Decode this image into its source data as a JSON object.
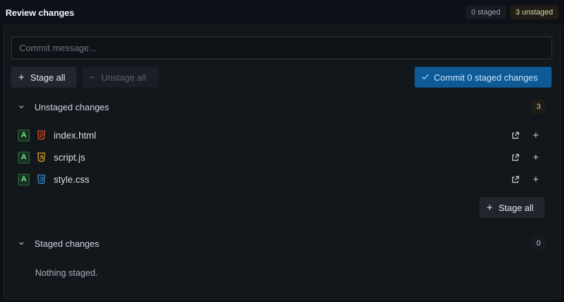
{
  "header": {
    "title": "Review changes",
    "staged_badge": "0 staged",
    "unstaged_badge": "3 unstaged"
  },
  "commit": {
    "placeholder": "Commit message...",
    "value": ""
  },
  "toolbar": {
    "stage_all_label": "Stage all",
    "unstage_all_label": "Unstage all",
    "commit_label": "Commit 0 staged changes"
  },
  "unstaged": {
    "label": "Unstaged changes",
    "count": "3",
    "files": [
      {
        "status": "A",
        "name": "index.html",
        "type_icon": "html5-icon",
        "type_color": "#e34c26"
      },
      {
        "status": "A",
        "name": "script.js",
        "type_icon": "js-icon",
        "type_color": "#d9a22a"
      },
      {
        "status": "A",
        "name": "style.css",
        "type_icon": "css3-icon",
        "type_color": "#3b8fd8"
      }
    ],
    "stage_all_label": "Stage all"
  },
  "staged": {
    "label": "Staged changes",
    "count": "0",
    "empty_text": "Nothing staged."
  },
  "colors": {
    "accent": "#0d5a97",
    "added": "#7ee787",
    "warn_badge": "#e5d6a8"
  }
}
